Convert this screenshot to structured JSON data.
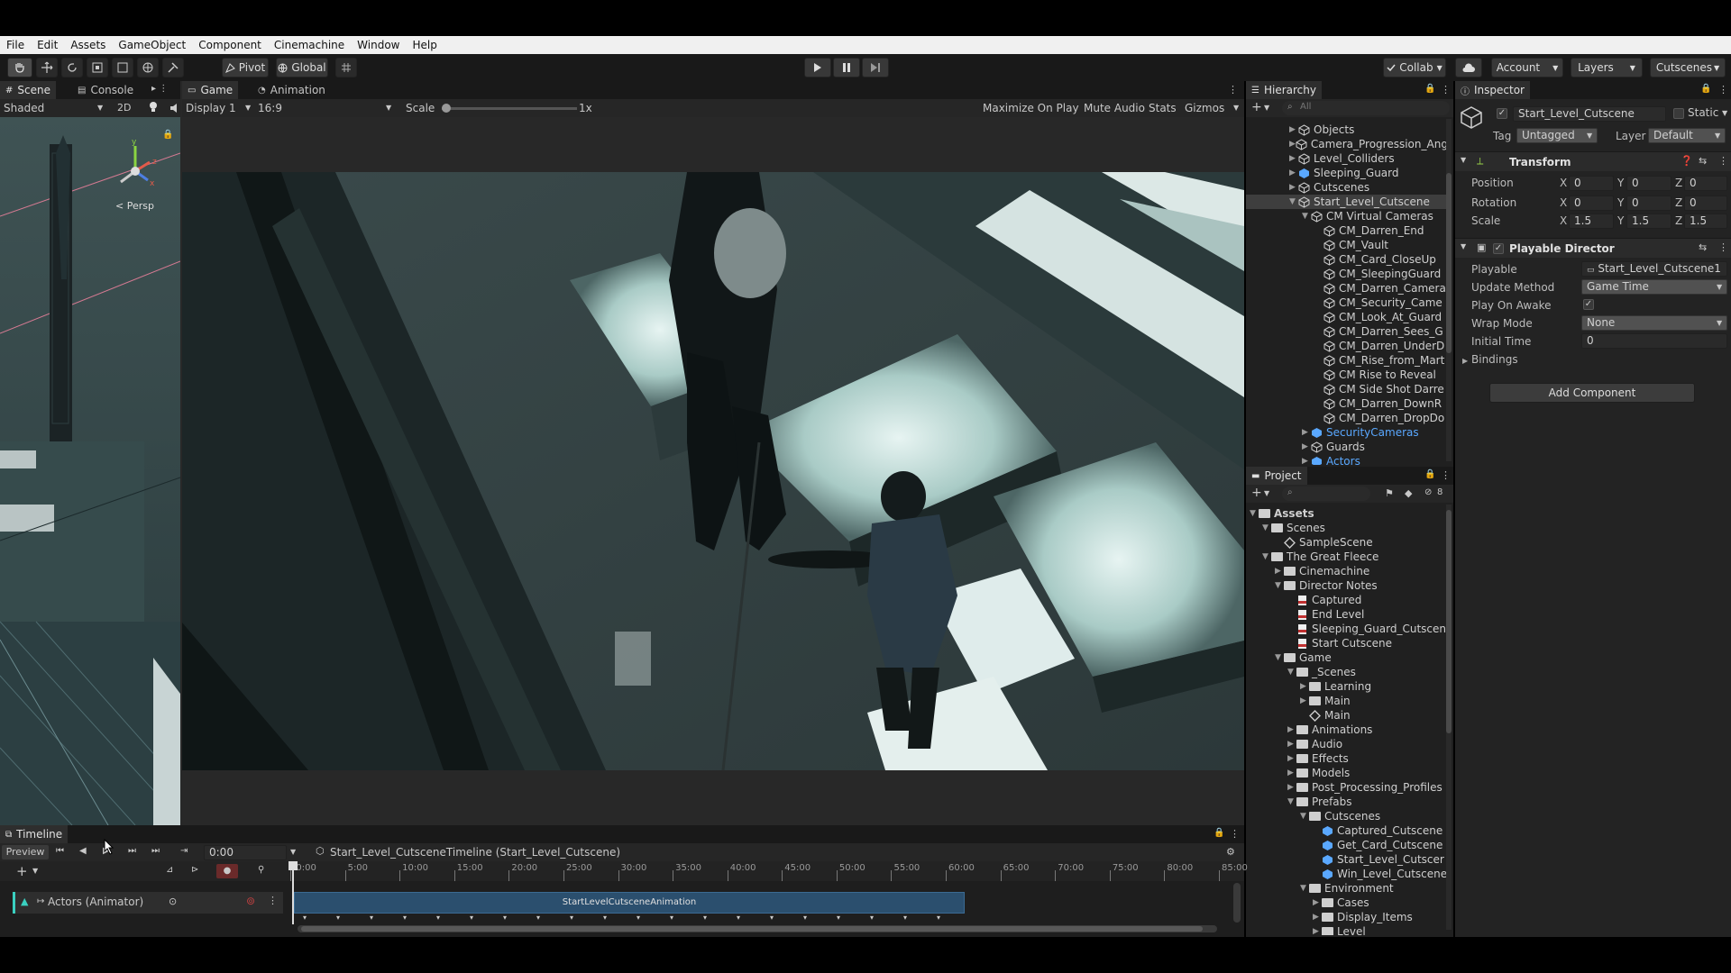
{
  "menu": [
    "File",
    "Edit",
    "Assets",
    "GameObject",
    "Component",
    "Cinemachine",
    "Window",
    "Help"
  ],
  "toolbar": {
    "pivot": "Pivot",
    "global": "Global",
    "collab": "Collab",
    "account": "Account",
    "layers": "Layers",
    "layout": "Cutscenes"
  },
  "scene": {
    "tabs": [
      "Scene",
      "Console"
    ],
    "shading": "Shaded",
    "mode_2d": "2D",
    "persp": "< Persp"
  },
  "game": {
    "tabs": [
      "Game",
      "Animation"
    ],
    "display": "Display 1",
    "aspect": "16:9",
    "scale_label": "Scale",
    "scale_value": "1x",
    "scale_fraction": 0.0,
    "maximize": "Maximize On Play",
    "mute": "Mute Audio",
    "stats": "Stats",
    "gizmos": "Gizmos"
  },
  "hierarchy": {
    "title": "Hierarchy",
    "search_placeholder": "All",
    "items": [
      {
        "label": "Objects",
        "depth": 0,
        "kind": "go",
        "expanded": false,
        "color": "normal"
      },
      {
        "label": "Camera_Progression_Ang",
        "depth": 0,
        "kind": "go",
        "expanded": false,
        "color": "normal"
      },
      {
        "label": "Level_Colliders",
        "depth": 0,
        "kind": "go",
        "expanded": false,
        "color": "normal"
      },
      {
        "label": "Sleeping_Guard",
        "depth": 0,
        "kind": "prefab",
        "expanded": false,
        "color": "normal"
      },
      {
        "label": "Cutscenes",
        "depth": 0,
        "kind": "go",
        "expanded": false,
        "color": "normal"
      },
      {
        "label": "Start_Level_Cutscene",
        "depth": 0,
        "kind": "go",
        "expanded": true,
        "color": "normal",
        "selected": true
      },
      {
        "label": "CM Virtual Cameras",
        "depth": 1,
        "kind": "go",
        "expanded": true,
        "color": "normal"
      },
      {
        "label": "CM_Darren_End",
        "depth": 2,
        "kind": "go",
        "color": "normal"
      },
      {
        "label": "CM_Vault",
        "depth": 2,
        "kind": "go",
        "color": "normal"
      },
      {
        "label": "CM_Card_CloseUp",
        "depth": 2,
        "kind": "go",
        "color": "normal"
      },
      {
        "label": "CM_SleepingGuard",
        "depth": 2,
        "kind": "go",
        "color": "normal"
      },
      {
        "label": "CM_Darren_Camera",
        "depth": 2,
        "kind": "go",
        "color": "normal"
      },
      {
        "label": "CM_Security_Came",
        "depth": 2,
        "kind": "go",
        "color": "normal"
      },
      {
        "label": "CM_Look_At_Guard",
        "depth": 2,
        "kind": "go",
        "color": "normal"
      },
      {
        "label": "CM_Darren_Sees_G",
        "depth": 2,
        "kind": "go",
        "color": "normal"
      },
      {
        "label": "CM_Darren_UnderD",
        "depth": 2,
        "kind": "go",
        "color": "normal"
      },
      {
        "label": "CM_Rise_from_Mart",
        "depth": 2,
        "kind": "go",
        "color": "normal"
      },
      {
        "label": "CM Rise to Reveal",
        "depth": 2,
        "kind": "go",
        "color": "normal"
      },
      {
        "label": "CM Side Shot Darre",
        "depth": 2,
        "kind": "go",
        "color": "normal"
      },
      {
        "label": "CM_Darren_DownR",
        "depth": 2,
        "kind": "go",
        "color": "normal"
      },
      {
        "label": "CM_Darren_DropDo",
        "depth": 2,
        "kind": "go",
        "color": "normal"
      },
      {
        "label": "SecurityCameras",
        "depth": 1,
        "kind": "prefab",
        "expanded": false,
        "color": "blue"
      },
      {
        "label": "Guards",
        "depth": 1,
        "kind": "go",
        "expanded": false,
        "color": "normal"
      },
      {
        "label": "Actors",
        "depth": 1,
        "kind": "prefab",
        "expanded": false,
        "color": "blue"
      }
    ]
  },
  "project": {
    "title": "Project",
    "hidden_count": "8",
    "items": [
      {
        "label": "Assets",
        "depth": 0,
        "kind": "folder",
        "bold": true,
        "expanded": true
      },
      {
        "label": "Scenes",
        "depth": 1,
        "kind": "folder",
        "expanded": true
      },
      {
        "label": "SampleScene",
        "depth": 2,
        "kind": "scene"
      },
      {
        "label": "The Great Fleece",
        "depth": 1,
        "kind": "folder",
        "expanded": true
      },
      {
        "label": "Cinemachine",
        "depth": 2,
        "kind": "folder",
        "expanded": false
      },
      {
        "label": "Director Notes",
        "depth": 2,
        "kind": "folder",
        "expanded": true
      },
      {
        "label": "Captured",
        "depth": 3,
        "kind": "file"
      },
      {
        "label": "End Level",
        "depth": 3,
        "kind": "file"
      },
      {
        "label": "Sleeping_Guard_Cutscen",
        "depth": 3,
        "kind": "file"
      },
      {
        "label": "Start Cutscene",
        "depth": 3,
        "kind": "file"
      },
      {
        "label": "Game",
        "depth": 2,
        "kind": "folder",
        "expanded": true
      },
      {
        "label": "_Scenes",
        "depth": 3,
        "kind": "folder",
        "expanded": true
      },
      {
        "label": "Learning",
        "depth": 4,
        "kind": "folder",
        "expanded": false
      },
      {
        "label": "Main",
        "depth": 4,
        "kind": "folder",
        "expanded": false
      },
      {
        "label": "Main",
        "depth": 4,
        "kind": "scene"
      },
      {
        "label": "Animations",
        "depth": 3,
        "kind": "folder",
        "expanded": false
      },
      {
        "label": "Audio",
        "depth": 3,
        "kind": "folder",
        "expanded": false
      },
      {
        "label": "Effects",
        "depth": 3,
        "kind": "folder",
        "expanded": false
      },
      {
        "label": "Models",
        "depth": 3,
        "kind": "folder",
        "expanded": false
      },
      {
        "label": "Post_Processing_Profiles",
        "depth": 3,
        "kind": "folder",
        "expanded": false
      },
      {
        "label": "Prefabs",
        "depth": 3,
        "kind": "folder",
        "expanded": true
      },
      {
        "label": "Cutscenes",
        "depth": 4,
        "kind": "folder",
        "expanded": true
      },
      {
        "label": "Captured_Cutscene",
        "depth": 5,
        "kind": "prefab"
      },
      {
        "label": "Get_Card_Cutscene",
        "depth": 5,
        "kind": "prefab"
      },
      {
        "label": "Start_Level_Cutscer",
        "depth": 5,
        "kind": "prefab"
      },
      {
        "label": "Win_Level_Cutscene",
        "depth": 5,
        "kind": "prefab"
      },
      {
        "label": "Environment",
        "depth": 4,
        "kind": "folder",
        "expanded": true
      },
      {
        "label": "Cases",
        "depth": 5,
        "kind": "folder",
        "expanded": false
      },
      {
        "label": "Display_Items",
        "depth": 5,
        "kind": "folder",
        "expanded": false
      },
      {
        "label": "Level",
        "depth": 5,
        "kind": "folder",
        "expanded": false
      }
    ]
  },
  "inspector": {
    "title": "Inspector",
    "object_name": "Start_Level_Cutscene",
    "static_label": "Static",
    "tag_label": "Tag",
    "tag_value": "Untagged",
    "layer_label": "Layer",
    "layer_value": "Default",
    "transform": {
      "title": "Transform",
      "position_label": "Position",
      "rotation_label": "Rotation",
      "scale_label": "Scale",
      "position": [
        "0",
        "0",
        "0"
      ],
      "rotation": [
        "0",
        "0",
        "0"
      ],
      "scale": [
        "1.5",
        "1.5",
        "1.5"
      ]
    },
    "director": {
      "title": "Playable Director",
      "playable_label": "Playable",
      "playable_value": "Start_Level_Cutscene1",
      "update_label": "Update Method",
      "update_value": "Game Time",
      "awake_label": "Play On Awake",
      "wrap_label": "Wrap Mode",
      "wrap_value": "None",
      "initial_label": "Initial Time",
      "initial_value": "0",
      "bindings_label": "Bindings"
    },
    "add_component": "Add Component"
  },
  "timeline": {
    "title": "Timeline",
    "preview": "Preview",
    "time": "0:00",
    "asset": "Start_Level_CutsceneTimeline (Start_Level_Cutscene)",
    "track_label": "Actors (Animator)",
    "clip_label": "StartLevelCutsceneAnimation",
    "ruler": [
      ":0:00",
      "5:00",
      "10:00",
      "15:00",
      "20:00",
      "25:00",
      "30:00",
      "35:00",
      "40:00",
      "45:00",
      "50:00",
      "55:00",
      "60:00",
      "65:00",
      "70:00",
      "75:00",
      "80:00",
      "85:00"
    ]
  },
  "colors": {
    "accent_blue": "#5aa8ff",
    "selection": "#2c5d87",
    "clip": "#2b4f6e"
  }
}
